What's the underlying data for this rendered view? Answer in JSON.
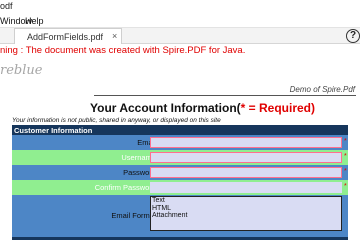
{
  "window": {
    "title_fragment": "odf"
  },
  "menu": {
    "items": [
      "Window",
      "Help"
    ]
  },
  "tabs": [
    {
      "label": "AddFormFields.pdf",
      "close": "×"
    }
  ],
  "help_glyph": "?",
  "document": {
    "warning": "ning : The document was created with Spire.PDF for Java.",
    "brand": "reblue",
    "demo_label": "Demo of Spire.Pdf",
    "heading": {
      "main": "Your Account Information(",
      "required": "* = Required)"
    },
    "notice": "Your information is not public, shared in anyway, or displayed on this site",
    "section_title": "Customer Information",
    "fields": [
      {
        "label": "Email",
        "required": true
      },
      {
        "label": "Username",
        "required": true
      },
      {
        "label": "Password",
        "required": true
      },
      {
        "label": "Confirm Password",
        "required": true
      },
      {
        "label": "Email Format",
        "options": [
          "Text",
          "HTML",
          "Attachment"
        ]
      }
    ],
    "required_mark": "*"
  },
  "colors": {
    "section_header": "#16365c",
    "row_blue": "#4d86c6",
    "row_green": "#90ee90",
    "field_fill": "#d9dcf3",
    "field_border": "#ff6f8f",
    "warning": "#e00000"
  }
}
